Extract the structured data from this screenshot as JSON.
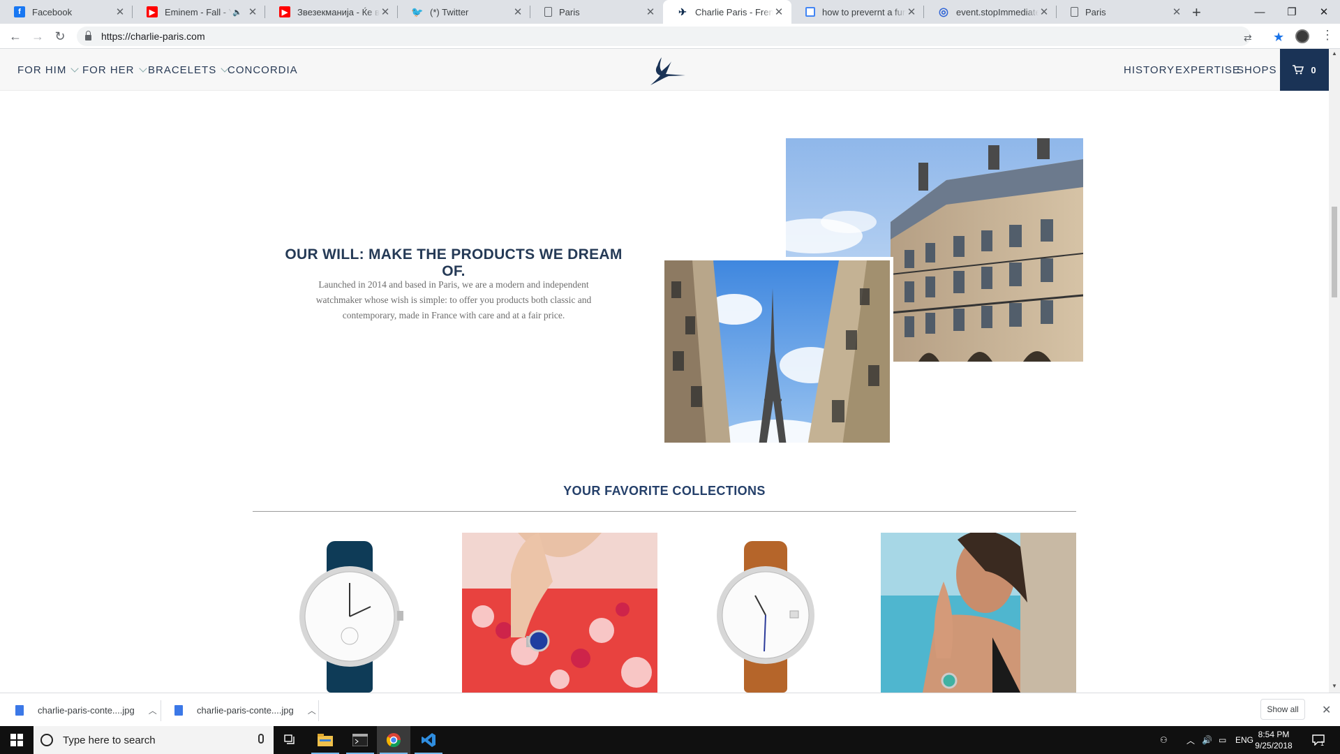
{
  "browser": {
    "tabs": [
      {
        "title": "Facebook",
        "icon": "facebook-icon",
        "active": false
      },
      {
        "title": "Eminem - Fall - You",
        "icon": "youtube-icon",
        "active": false,
        "muted_icon": "speaker-icon"
      },
      {
        "title": "Звезекманија - Ќе ви",
        "icon": "youtube-icon",
        "active": false
      },
      {
        "title": "(*) Twitter",
        "icon": "twitter-icon",
        "active": false
      },
      {
        "title": "Paris",
        "icon": "document-icon",
        "active": false
      },
      {
        "title": "Charlie Paris - French W",
        "icon": "charlie-paris-icon",
        "active": true
      },
      {
        "title": "how to prevernt a func",
        "icon": "google-icon",
        "active": false
      },
      {
        "title": "event.stopImmediatePr",
        "icon": "webpage-icon",
        "active": false
      },
      {
        "title": "Paris",
        "icon": "document-icon",
        "active": false
      }
    ],
    "url": "https://charlie-paris.com"
  },
  "site": {
    "nav_left": [
      {
        "label": "FOR HIM",
        "has_dropdown": true
      },
      {
        "label": "FOR HER",
        "has_dropdown": true
      },
      {
        "label": "BRACELETS",
        "has_dropdown": true
      },
      {
        "label": "CONCORDIA",
        "has_dropdown": false
      }
    ],
    "nav_right": [
      {
        "label": "HISTORY"
      },
      {
        "label": "EXPERTISE"
      },
      {
        "label": "SHOPS"
      }
    ],
    "cart_count": "0",
    "colors": {
      "brand_navy": "#1a3356",
      "nav_text": "#283a55"
    }
  },
  "intro": {
    "headline": "OUR WILL: MAKE THE PRODUCTS WE DREAM OF.",
    "body": "Launched in 2014 and based in Paris, we are a modern and independent watchmaker whose wish is simple: to offer you products both classic and contemporary, made in France with care and at a fair price."
  },
  "collections": {
    "title": "YOUR FAVORITE COLLECTIONS"
  },
  "downloads": {
    "items": [
      {
        "name": "charlie-paris-conte....jpg"
      },
      {
        "name": "charlie-paris-conte....jpg"
      }
    ],
    "show_all": "Show all"
  },
  "taskbar": {
    "search_placeholder": "Type here to search",
    "language": "ENG",
    "time": "8:54 PM",
    "date": "9/25/2018",
    "notification_count": "1"
  }
}
